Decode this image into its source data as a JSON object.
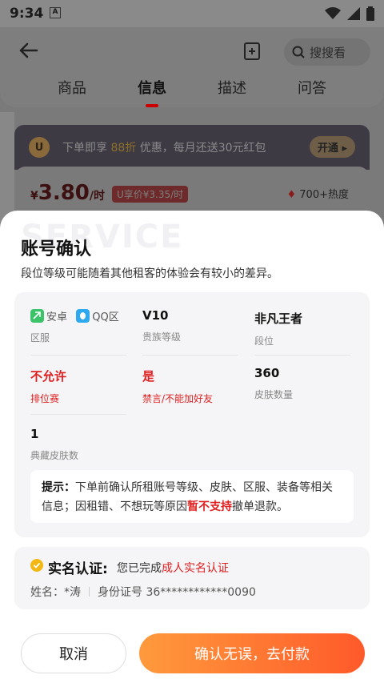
{
  "status": {
    "time": "9:34",
    "notif_icon": "A"
  },
  "header": {
    "search_label": "搜搜看",
    "tabs": [
      {
        "label": "商品",
        "active": false
      },
      {
        "label": "信息",
        "active": true
      },
      {
        "label": "描述",
        "active": false
      },
      {
        "label": "问答",
        "active": false
      }
    ]
  },
  "promo": {
    "badge": "U",
    "text_before": "下单即享",
    "discount": "88折",
    "text_after": "优惠，每月还送30元红包",
    "button": "开通"
  },
  "price": {
    "currency": "¥",
    "amount": "3.80",
    "unit": "/时",
    "member_price": "U享价¥3.35/时",
    "heat": "700+热度"
  },
  "sheet": {
    "watermark": "SERVICE",
    "title": "账号确认",
    "subtitle": "段位等级可能随着其他租客的体验会有较小的差异。",
    "server_chips": [
      "安卓",
      "QQ区"
    ],
    "server_label": "区服",
    "noble_value": "V10",
    "noble_label": "贵族等级",
    "rank_value": "非凡王者",
    "rank_label": "段位",
    "ranked_value": "不允许",
    "ranked_label": "排位赛",
    "ban_value": "是",
    "ban_label": "禁言/不能加好友",
    "skins_value": "360",
    "skins_label": "皮肤数量",
    "rare_value": "1",
    "rare_label": "典藏皮肤数",
    "tip_prefix": "提示：",
    "tip_text": "下单前确认所租账号等级、皮肤、区服、装备等相关信息；因租错、不想玩等原因",
    "tip_red": "暂不支持",
    "tip_end": "撤单退款。"
  },
  "auth": {
    "title": "实名认证:",
    "desc_prefix": "您已完成",
    "desc_red": "成人实名认证",
    "name": "姓名：*涛",
    "id_number": "身份证号 36************0090"
  },
  "buttons": {
    "cancel": "取消",
    "confirm": "确认无误，去付款"
  },
  "colors": {
    "accent": "#ff6a2f",
    "red": "#e02020"
  }
}
